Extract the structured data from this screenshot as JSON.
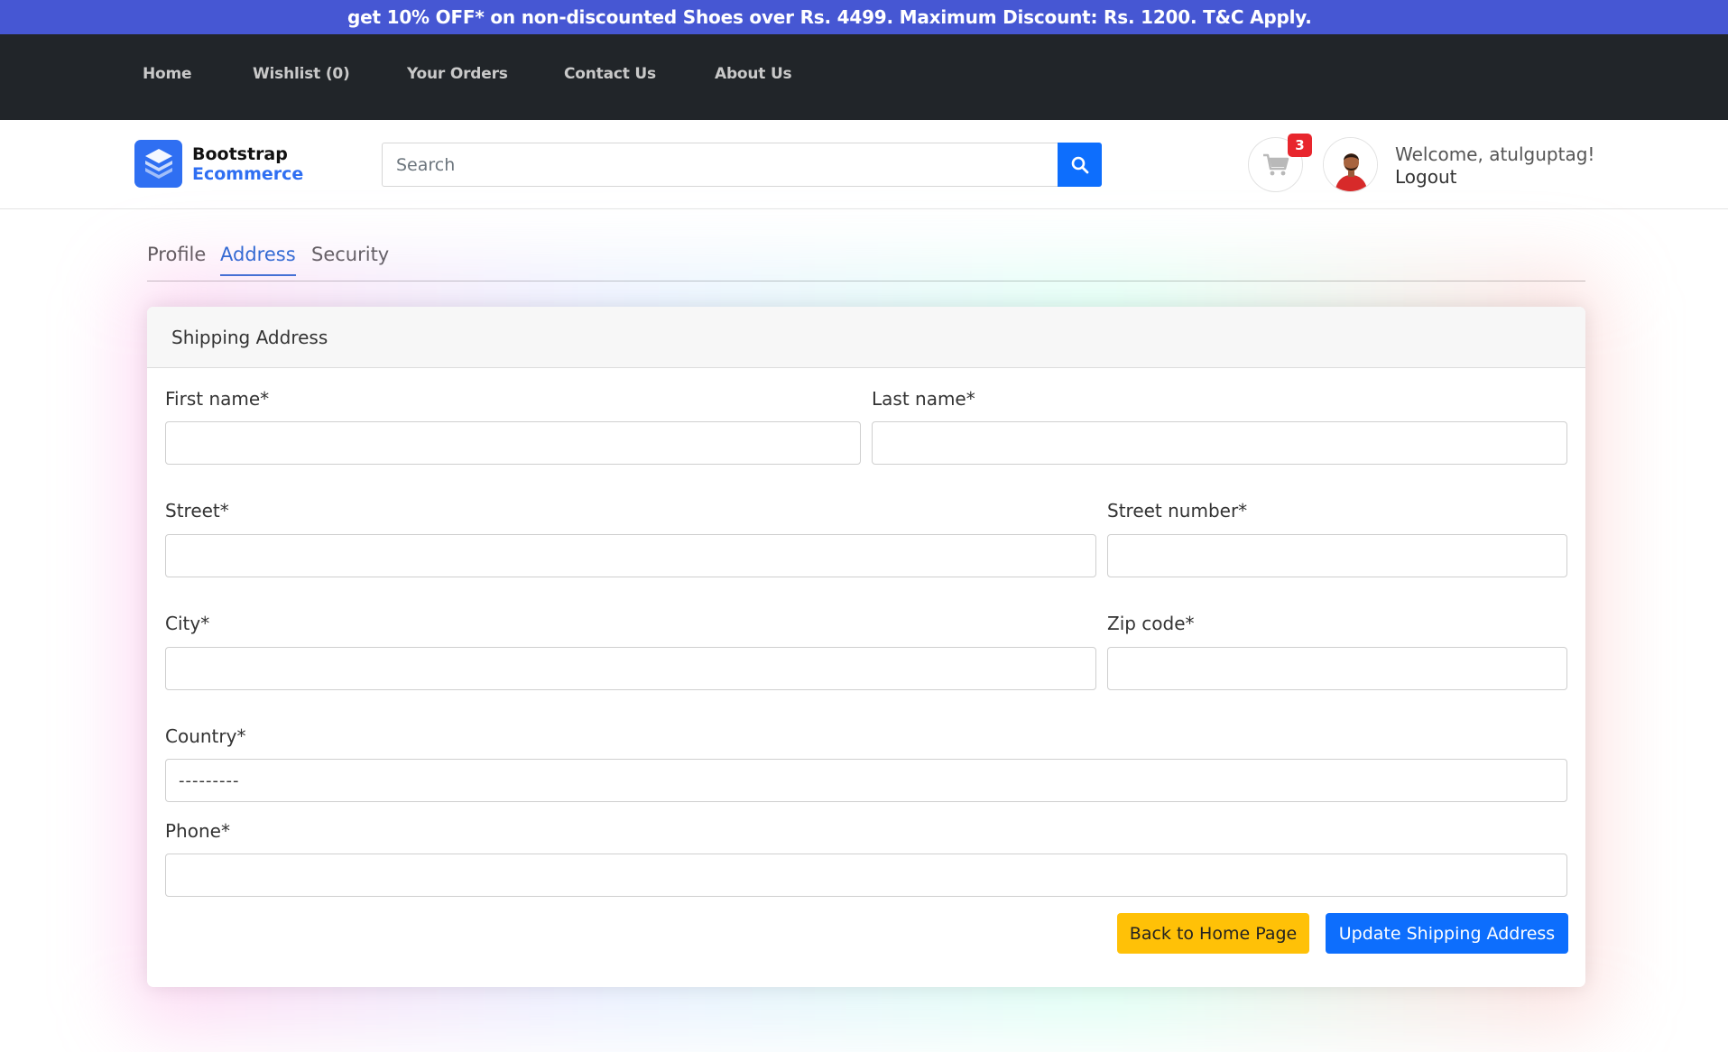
{
  "promo": {
    "text": "get 10% OFF* on non-discounted Shoes over Rs. 4499. Maximum Discount: Rs. 1200. T&C Apply."
  },
  "nav": {
    "items": [
      {
        "label": "Home"
      },
      {
        "label": "Wishlist (0)"
      },
      {
        "label": "Your Orders"
      },
      {
        "label": "Contact Us"
      },
      {
        "label": "About Us"
      }
    ]
  },
  "brand": {
    "line1": "Bootstrap",
    "line2": "Ecommerce",
    "accent_color": "#2f6ff2"
  },
  "search": {
    "placeholder": "Search",
    "value": ""
  },
  "cart": {
    "count": "3"
  },
  "user": {
    "welcome": "Welcome, atulguptag!",
    "logout": "Logout"
  },
  "tabs": [
    {
      "label": "Profile",
      "active": false
    },
    {
      "label": "Address",
      "active": true
    },
    {
      "label": "Security",
      "active": false
    }
  ],
  "form": {
    "title": "Shipping Address",
    "fields": {
      "first_name": {
        "label": "First name*",
        "value": ""
      },
      "last_name": {
        "label": "Last name*",
        "value": ""
      },
      "street": {
        "label": "Street*",
        "value": ""
      },
      "street_number": {
        "label": "Street number*",
        "value": ""
      },
      "city": {
        "label": "City*",
        "value": ""
      },
      "zip_code": {
        "label": "Zip code*",
        "value": ""
      },
      "country": {
        "label": "Country*",
        "selected": "---------"
      },
      "phone": {
        "label": "Phone*",
        "value": ""
      }
    },
    "buttons": {
      "back": "Back to Home Page",
      "update": "Update Shipping Address"
    }
  },
  "colors": {
    "promo_bg": "#4657d3",
    "nav_bg": "#212529",
    "primary": "#0d6efd",
    "warning": "#ffc107",
    "badge": "#e8262d"
  }
}
